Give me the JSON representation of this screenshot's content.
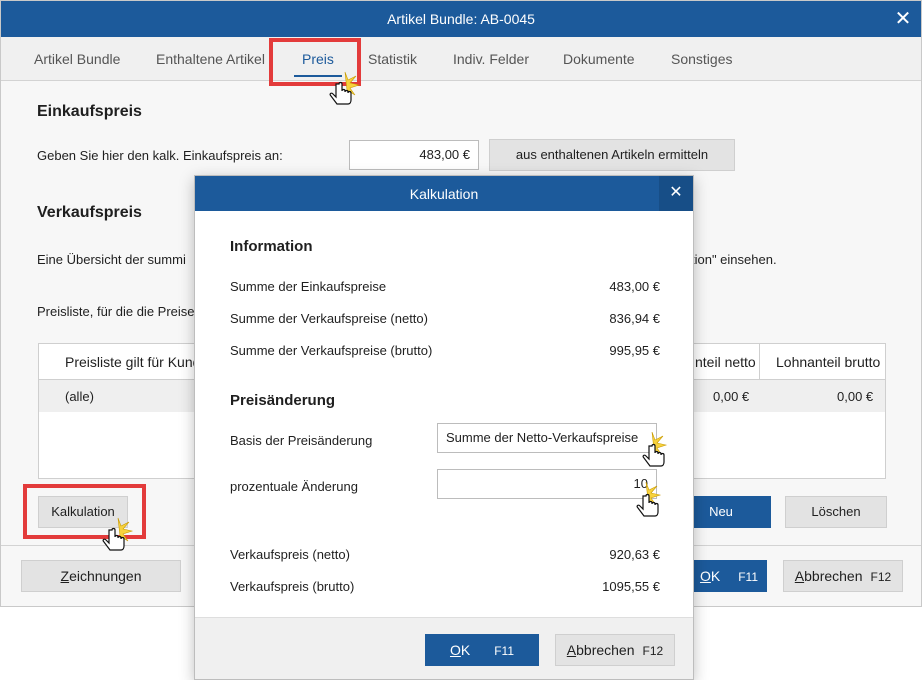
{
  "window": {
    "title": "Artikel Bundle: AB-0045",
    "close_glyph": "✕"
  },
  "tabs": [
    {
      "label": "Artikel Bundle"
    },
    {
      "label": "Enthaltene Artikel"
    },
    {
      "label": "Preis",
      "active": true
    },
    {
      "label": "Statistik"
    },
    {
      "label": "Indiv. Felder"
    },
    {
      "label": "Dokumente"
    },
    {
      "label": "Sonstiges"
    }
  ],
  "einkaufspreis": {
    "title": "Einkaufspreis",
    "prompt": "Geben Sie hier den kalk. Einkaufspreis an:",
    "value": "483,00 €",
    "calc_button": "aus enthaltenen Artikeln ermitteln"
  },
  "verkaufspreis": {
    "title": "Verkaufspreis",
    "desc_left": "Eine Übersicht der summi",
    "desc_right": "tion\" einsehen.",
    "preisliste_label": "Preisliste, für die die Preise"
  },
  "grid": {
    "headers": {
      "col1": "Preisliste gilt für Kund",
      "col_net": "nteil netto",
      "col_gross": "Lohnanteil brutto"
    },
    "rows": [
      {
        "col1": "(alle)",
        "net": "0,00 €",
        "gross": "0,00 €"
      }
    ]
  },
  "buttons": {
    "kalkulation": "Kalkulation",
    "neu": "Neu",
    "loeschen": "Löschen",
    "zeichnungen_underlined": "Z",
    "zeichnungen_rest": "eichnungen",
    "ok_underlined": "O",
    "ok_rest": "K",
    "ok_shortcut": "F11",
    "abbrechen_underlined": "A",
    "abbrechen_rest": "bbrechen",
    "abbrechen_shortcut": "F12"
  },
  "modal": {
    "title": "Kalkulation",
    "close_glyph": "✕",
    "information": {
      "title": "Information",
      "rows": [
        {
          "label": "Summe der Einkaufspreise",
          "value": "483,00 €"
        },
        {
          "label": "Summe der Verkaufspreise (netto)",
          "value": "836,94 €"
        },
        {
          "label": "Summe der Verkaufspreise (brutto)",
          "value": "995,95 €"
        }
      ]
    },
    "preisaenderung": {
      "title": "Preisänderung",
      "basis_label": "Basis der Preisänderung",
      "basis_value": "Summe der Netto-Verkaufspreise",
      "prozent_label": "prozentuale Änderung",
      "prozent_value": "10"
    },
    "results": [
      {
        "label": "Verkaufspreis (netto)",
        "value": "920,63 €"
      },
      {
        "label": "Verkaufspreis (brutto)",
        "value": "1095,55 €"
      }
    ],
    "footer": {
      "ok_underlined": "O",
      "ok_rest": "K",
      "ok_shortcut": "F11",
      "abbrechen_underlined": "A",
      "abbrechen_rest": "bbrechen",
      "abbrechen_shortcut": "F12"
    }
  },
  "colors": {
    "accent": "#1c5a9b",
    "highlight": "#e33b3b"
  }
}
